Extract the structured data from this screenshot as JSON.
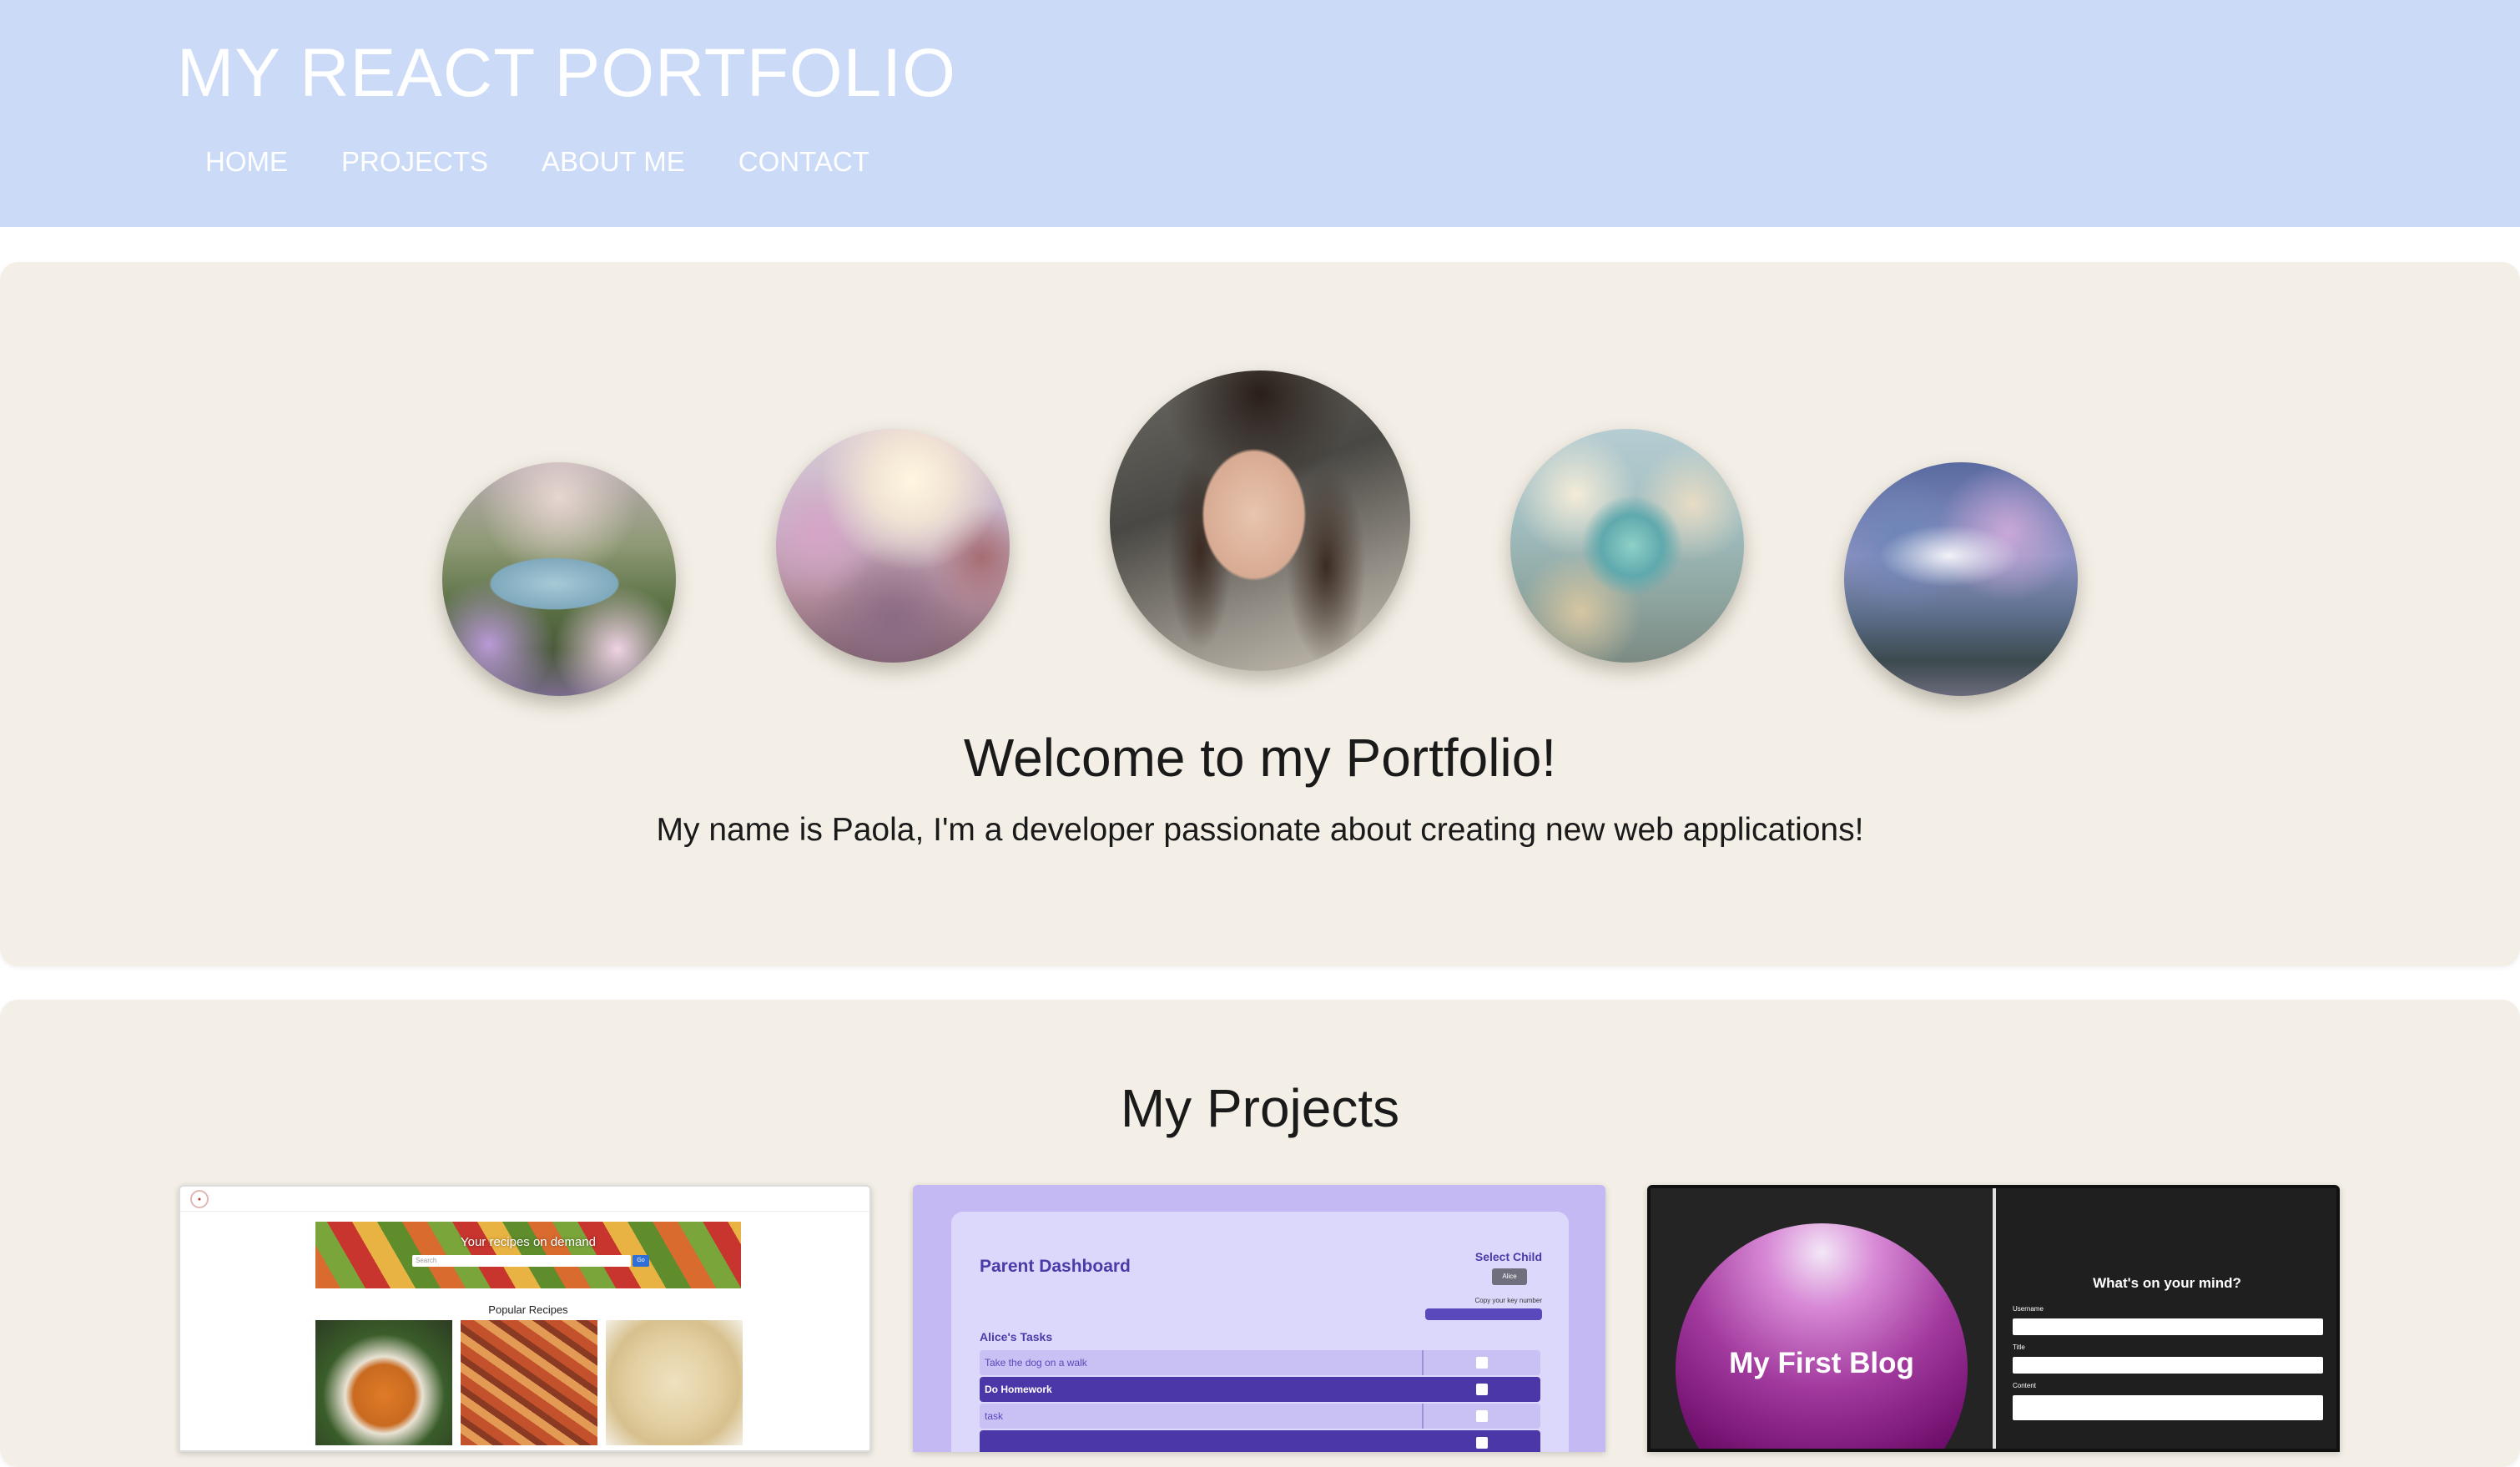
{
  "header": {
    "title": "MY REACT PORTFOLIO",
    "nav": [
      "HOME",
      "PROJECTS",
      "ABOUT ME",
      "CONTACT"
    ]
  },
  "hero": {
    "title": "Welcome to my Portfolio!",
    "subtitle": "My name is Paola, I'm a developer passionate about creating new web applications!"
  },
  "projects": {
    "title": "My Projects",
    "recipe_card": {
      "banner": "Your recipes on demand",
      "search_placeholder": "Search",
      "search_button": "Go",
      "section": "Popular Recipes"
    },
    "dashboard_card": {
      "title": "Parent Dashboard",
      "select_label": "Select Child",
      "select_value": "Alice",
      "copy_label": "Copy your key number",
      "tasks_title": "Alice's Tasks",
      "tasks": [
        "Take the dog on a walk",
        "Do Homework",
        "task"
      ]
    },
    "blog_card": {
      "title": "My First Blog",
      "form_title": "What's on your mind?",
      "fields": [
        "Username",
        "Title",
        "Content"
      ]
    }
  },
  "colors": {
    "header_bg": "#cbdaf7",
    "panel_bg": "#f3efe7",
    "dashboard_accent": "#4b3aa8",
    "blog_accent": "#6f0e6c"
  }
}
